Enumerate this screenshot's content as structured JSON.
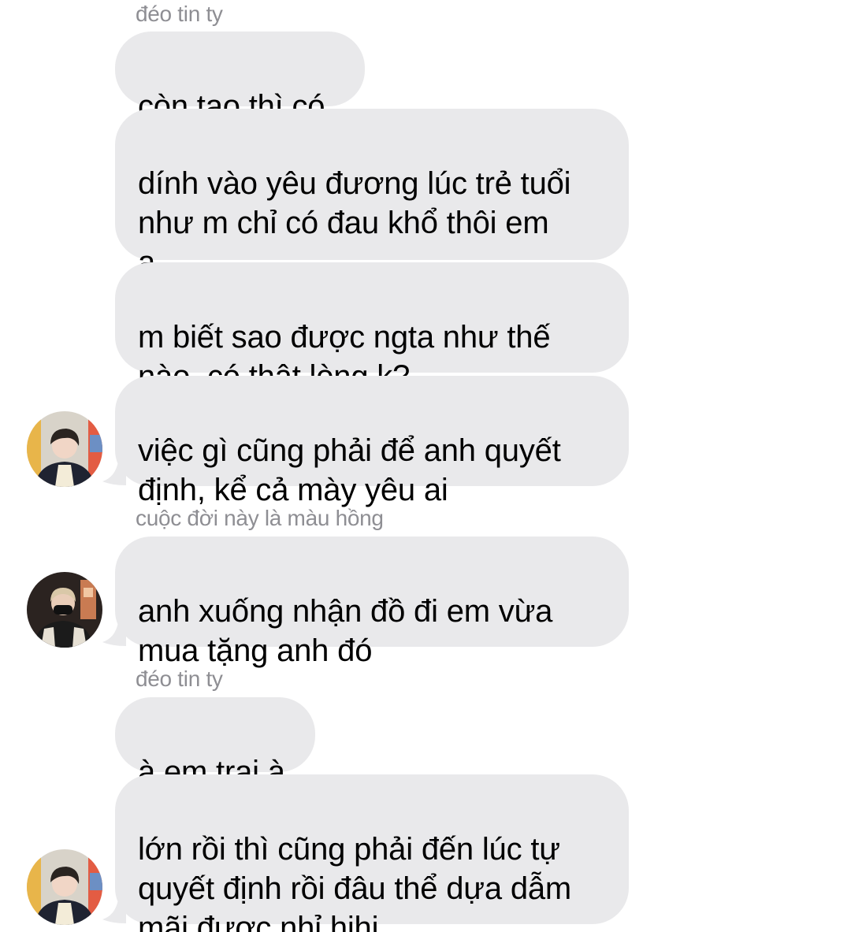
{
  "conversation": {
    "sender_labels": {
      "first": "đéo tin ty",
      "second": "cuộc đời này là màu hồng",
      "third": "đéo tin ty"
    },
    "messages": [
      {
        "text": "còn tao thì có"
      },
      {
        "text": "dính vào yêu đương lúc trẻ tuổi\nnhư m chỉ có đau khổ thôi em\nạ"
      },
      {
        "text": "m biết sao được ngta như thế\nnào, có thật lòng k?"
      },
      {
        "text": "việc gì cũng phải để anh quyết\nđịnh, kể cả mày yêu ai"
      },
      {
        "text": "anh xuống nhận đồ đi em vừa\nmua tặng anh đó"
      },
      {
        "text": "à em trai à"
      },
      {
        "text": "lớn rồi thì cũng phải đến lúc tự\nquyết định rồi đâu thể dựa dẫm\nmãi được nhỉ hihi"
      }
    ]
  },
  "colors": {
    "bubble_background": "#e9e9eb",
    "sender_text": "#8e8e93",
    "message_text": "#000000",
    "page_background": "#ffffff"
  }
}
